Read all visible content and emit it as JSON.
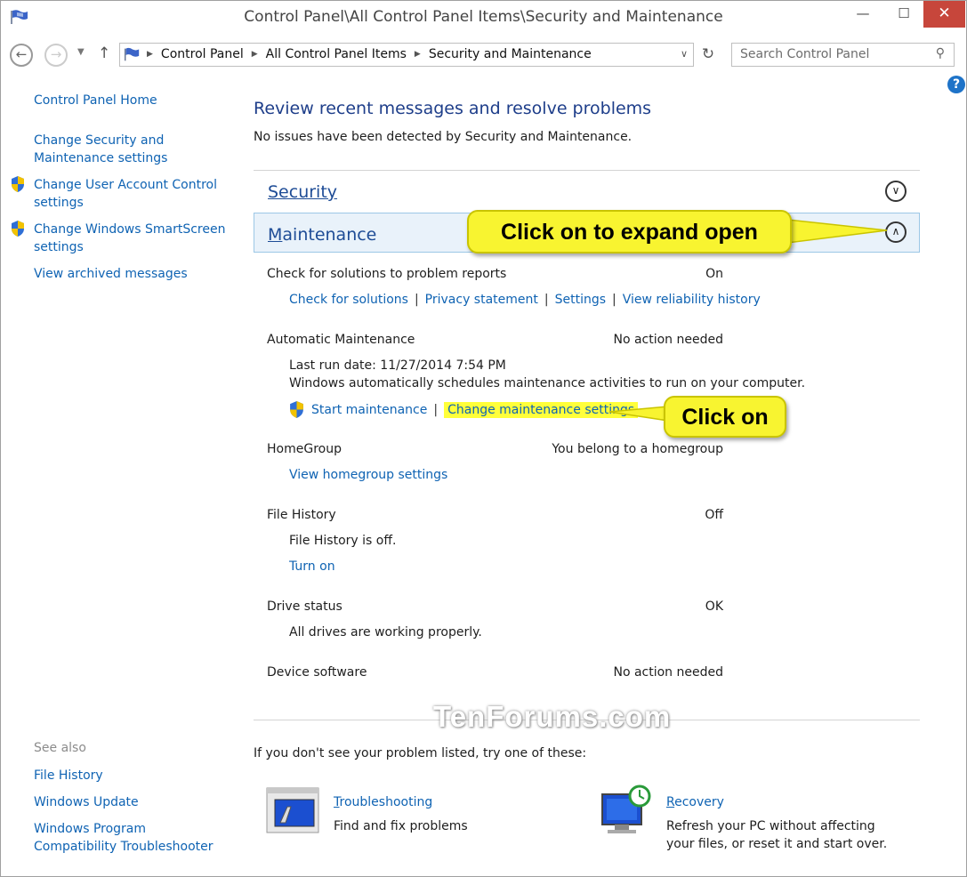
{
  "window": {
    "title": "Control Panel\\All Control Panel Items\\Security and Maintenance",
    "minimize": "—",
    "maximize": "☐",
    "close": "✕"
  },
  "address": {
    "crumbs": [
      "Control Panel",
      "All Control Panel Items",
      "Security and Maintenance"
    ],
    "search_placeholder": "Search Control Panel"
  },
  "left_pane": {
    "home": "Control Panel Home",
    "links": [
      {
        "line1": "Change Security and",
        "line2": "Maintenance settings",
        "shield": false
      },
      {
        "line1": "Change User Account Control",
        "line2": "settings",
        "shield": true
      },
      {
        "line1": "Change Windows SmartScreen",
        "line2": "settings",
        "shield": true
      },
      {
        "line1": "View archived messages",
        "line2": "",
        "shield": false
      }
    ],
    "see_also_heading": "See also",
    "see_also": [
      "File History",
      "Windows Update",
      "Windows Program",
      "Compatibility Troubleshooter"
    ]
  },
  "main": {
    "heading": "Review recent messages and resolve problems",
    "subtext": "No issues have been detected by Security and Maintenance.",
    "security_title": "Security",
    "maintenance_title_initial": "M",
    "maintenance_title_rest": "aintenance",
    "rows": {
      "solutions": {
        "label": "Check for solutions to problem reports",
        "status": "On",
        "links": [
          "Check for solutions",
          "Privacy statement",
          "Settings",
          "View reliability history"
        ]
      },
      "auto": {
        "label": "Automatic Maintenance",
        "status": "No action needed",
        "last_run": "Last run date: 11/27/2014 7:54 PM",
        "desc": "Windows automatically schedules maintenance activities to run on your computer.",
        "start": "Start maintenance",
        "change": "Change maintenance settings"
      },
      "homegroup": {
        "label": "HomeGroup",
        "status": "You belong to a homegroup",
        "link": "View homegroup settings"
      },
      "filehistory": {
        "label": "File History",
        "status": "Off",
        "desc": "File History is off.",
        "link": "Turn on"
      },
      "drive": {
        "label": "Drive status",
        "status": "OK",
        "desc": "All drives are working properly."
      },
      "device": {
        "label": "Device software",
        "status": "No action needed"
      }
    },
    "alt_text": "If you don't see your problem listed, try one of these:",
    "troubleshooting": {
      "title_initial": "T",
      "title_rest": "roubleshooting",
      "desc": "Find and fix problems"
    },
    "recovery": {
      "title_initial": "R",
      "title_rest": "ecovery",
      "desc1": "Refresh your PC without affecting",
      "desc2": "your files, or reset it and start over."
    }
  },
  "callouts": {
    "expand": "Click on to expand open",
    "click": "Click on"
  },
  "watermark": "TenForums.com",
  "colors": {
    "link": "#0f63b3",
    "heading": "#1e3e8a",
    "close_button": "#c7463b",
    "callout": "#f8f430",
    "highlight": "#ffff3a"
  }
}
